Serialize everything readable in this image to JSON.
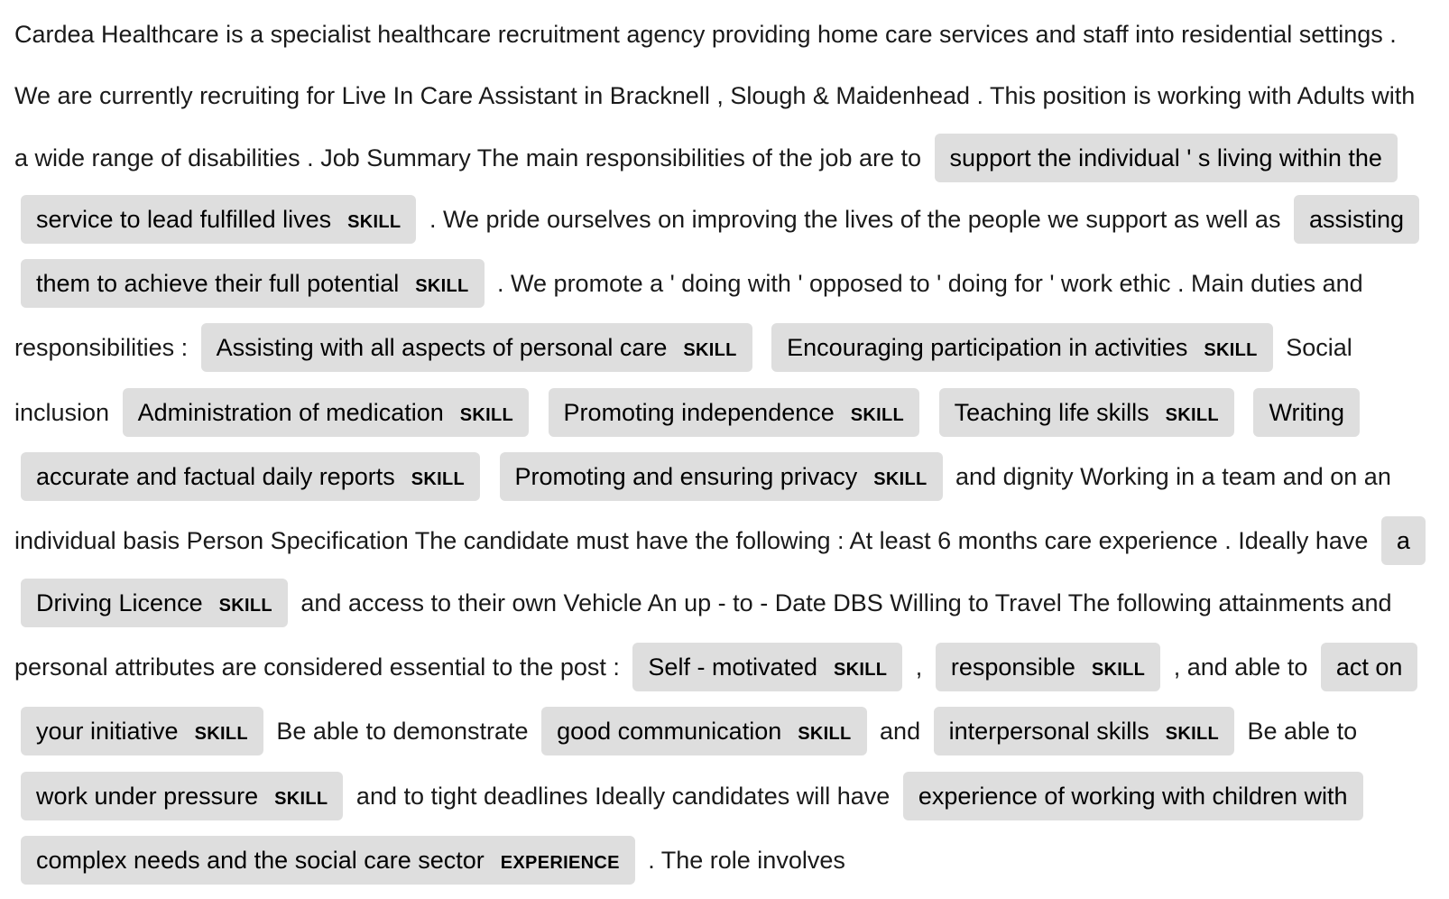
{
  "segments": [
    {
      "type": "text",
      "text": "Cardea Healthcare is a specialist healthcare recruitment agency providing home care services and staff into residential settings . We are currently recruiting for Live In Care Assistant in Bracknell , Slough & Maidenhead . This position is working with Adults with a wide range of disabilities . Job Summary The main responsibilities of the job are to"
    },
    {
      "type": "entity",
      "text": "support the individual ' s living within the service to lead fulfilled lives",
      "label": "SKILL"
    },
    {
      "type": "text",
      "text": ". We pride ourselves on improving the lives of the people we support as well as"
    },
    {
      "type": "entity",
      "text": "assisting them to achieve their full potential",
      "label": "SKILL"
    },
    {
      "type": "text",
      "text": ". We promote a ' doing with ' opposed to ' doing for ' work ethic . Main duties and responsibilities :"
    },
    {
      "type": "entity",
      "text": "Assisting with all aspects of personal care",
      "label": "SKILL"
    },
    {
      "type": "entity",
      "text": "Encouraging participation in activities",
      "label": "SKILL"
    },
    {
      "type": "text",
      "text": "Social inclusion"
    },
    {
      "type": "entity",
      "text": "Administration of medication",
      "label": "SKILL"
    },
    {
      "type": "entity",
      "text": "Promoting independence",
      "label": "SKILL"
    },
    {
      "type": "entity",
      "text": "Teaching life skills",
      "label": "SKILL"
    },
    {
      "type": "entity",
      "text": "Writing accurate and factual daily reports",
      "label": "SKILL"
    },
    {
      "type": "entity",
      "text": "Promoting and ensuring privacy",
      "label": "SKILL"
    },
    {
      "type": "text",
      "text": "and dignity Working in a team and on an individual basis Person Specification The candidate must have the following : At least 6 months care experience . Ideally have"
    },
    {
      "type": "entity",
      "text": "a Driving Licence",
      "label": "SKILL"
    },
    {
      "type": "text",
      "text": "and access to their own Vehicle An up - to - Date DBS Willing to Travel The following attainments and personal attributes are considered essential to the post :"
    },
    {
      "type": "entity",
      "text": "Self - motivated",
      "label": "SKILL"
    },
    {
      "type": "text",
      "text": ","
    },
    {
      "type": "entity",
      "text": "responsible",
      "label": "SKILL"
    },
    {
      "type": "text",
      "text": ", and able to"
    },
    {
      "type": "entity",
      "text": "act on your initiative",
      "label": "SKILL"
    },
    {
      "type": "text",
      "text": "Be able to demonstrate"
    },
    {
      "type": "entity",
      "text": "good communication",
      "label": "SKILL"
    },
    {
      "type": "text",
      "text": "and"
    },
    {
      "type": "entity",
      "text": "interpersonal skills",
      "label": "SKILL"
    },
    {
      "type": "text",
      "text": "Be able to"
    },
    {
      "type": "entity",
      "text": "work under pressure",
      "label": "SKILL"
    },
    {
      "type": "text",
      "text": "and to tight deadlines Ideally candidates will have"
    },
    {
      "type": "entity",
      "text": "experience of working with children with complex needs and the social care sector",
      "label": "EXPERIENCE"
    },
    {
      "type": "text",
      "text": ". The role involves"
    }
  ]
}
